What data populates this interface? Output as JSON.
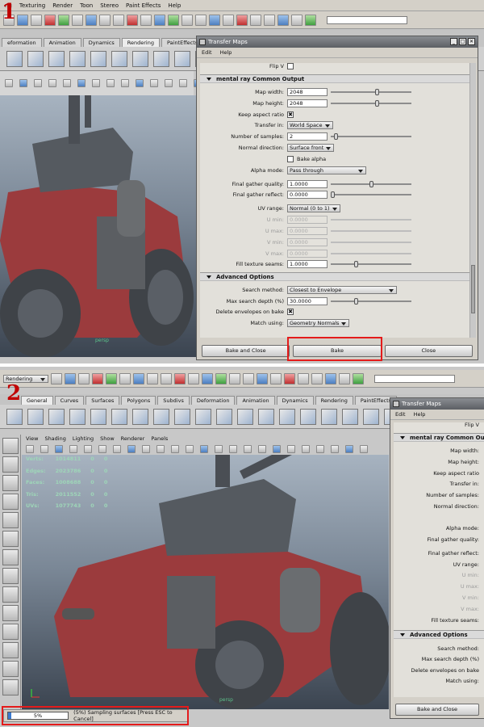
{
  "steps": [
    "1",
    "2"
  ],
  "maya": {
    "menus": [
      "ng",
      "Texturing",
      "Render",
      "Toon",
      "Stereo",
      "Paint Effects",
      "Help"
    ],
    "menuset": "Rendering",
    "shelf_tabs_1": [
      "eformation",
      "Animation",
      "Dynamics",
      "Rendering",
      "PaintEffects"
    ],
    "shelf_tabs_2": [
      "General",
      "Curves",
      "Surfaces",
      "Polygons",
      "Subdivs",
      "Deformation",
      "Animation",
      "Dynamics",
      "Rendering",
      "PaintEffects"
    ],
    "viewport_menus": [
      "View",
      "Shading",
      "Lighting",
      "Show",
      "Renderer",
      "Panels"
    ],
    "camera_label": "persp",
    "stats": [
      {
        "label": "Verts:",
        "v1": "1014811",
        "v2": "0",
        "v3": "0"
      },
      {
        "label": "Edges:",
        "v1": "2023786",
        "v2": "0",
        "v3": "0"
      },
      {
        "label": "Faces:",
        "v1": "1008688",
        "v2": "0",
        "v3": "0"
      },
      {
        "label": "Tris:",
        "v1": "2011552",
        "v2": "0",
        "v3": "0"
      },
      {
        "label": "UVs:",
        "v1": "1077743",
        "v2": "0",
        "v3": "0"
      }
    ],
    "progress": {
      "percent_label": "5%",
      "fraction": 0.05,
      "message": "(5%) Sampling surfaces [Press ESC to Cancel]"
    }
  },
  "dialog": {
    "title": "Transfer Maps",
    "menu": [
      "Edit",
      "Help"
    ],
    "flip_v": "Flip V",
    "common_output": "mental ray Common Output",
    "fields": {
      "map_width": {
        "label": "Map width:",
        "value": "2048",
        "slider": 0.58
      },
      "map_height": {
        "label": "Map height:",
        "value": "2048",
        "slider": 0.58
      },
      "keep_aspect": {
        "label": "Keep aspect ratio"
      },
      "transfer_in": {
        "label": "Transfer in:",
        "value": "World Space"
      },
      "num_samples": {
        "label": "Number of samples:",
        "value": "2",
        "slider": 0.04
      },
      "normal_dir": {
        "label": "Normal direction:",
        "value": "Surface front"
      },
      "bake_alpha": {
        "label": "Bake alpha"
      },
      "alpha_mode": {
        "label": "Alpha mode:",
        "value": "Pass through"
      },
      "fg_quality": {
        "label": "Final gather quality:",
        "value": "1.0000",
        "slider": 0.5
      },
      "fg_reflect": {
        "label": "Final gather reflect:",
        "value": "0.0000",
        "slider": 0.0
      },
      "uv_range": {
        "label": "UV range:",
        "value": "Normal (0 to 1)"
      },
      "u_min": {
        "label": "U min:",
        "value": "0.0000"
      },
      "u_max": {
        "label": "U max:",
        "value": "0.0000"
      },
      "v_min": {
        "label": "V min:",
        "value": "0.0000"
      },
      "v_max": {
        "label": "V max:",
        "value": "0.0000"
      },
      "fill_seams": {
        "label": "Fill texture seams:",
        "value": "1.0000",
        "slider": 0.3
      }
    },
    "advanced": "Advanced Options",
    "adv": {
      "search_method": {
        "label": "Search method:",
        "value": "Closest to Envelope"
      },
      "max_depth": {
        "label": "Max search depth (%)",
        "value": "30.0000",
        "slider": 0.3
      },
      "delete_env": {
        "label": "Delete envelopes on bake"
      },
      "match_using": {
        "label": "Match using:",
        "value": "Geometry Normals"
      }
    },
    "buttons": {
      "bake_close": "Bake and Close",
      "bake": "Bake",
      "close": "Close"
    },
    "checked_mark": "✖"
  },
  "dialog2_labels": {
    "flip_v": "Flip V",
    "common_output": "mental ray Common Outp",
    "rows": [
      "Map width:",
      "Map height:",
      "Keep aspect ratio",
      "Transfer in:",
      "Number of samples:",
      "Normal direction:",
      "Alpha mode:",
      "Final gather quality:",
      "Final gather reflect:",
      "UV range:",
      "U min:",
      "U max:",
      "V min:",
      "V max:",
      "Fill texture seams:"
    ],
    "advanced": "Advanced Options",
    "adv_rows": [
      "Search method:",
      "Max search depth (%)",
      "Delete envelopes on bake",
      "Match using:"
    ],
    "button": "Bake and Close"
  },
  "colors": {
    "highlight": "#e41b1b",
    "step_number": "#c00000",
    "tank_body": "#9b3b3d",
    "tank_turret": "#555a60"
  }
}
